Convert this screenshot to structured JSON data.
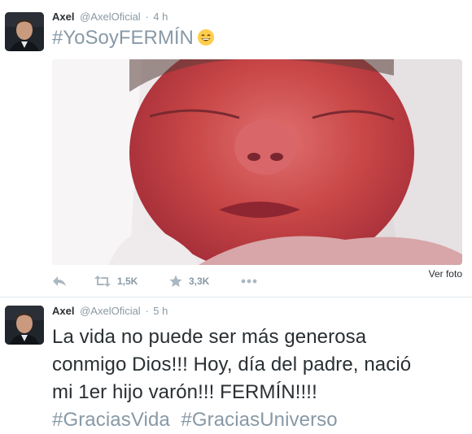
{
  "tweets": [
    {
      "name": "Axel",
      "handle": "@AxelOficial",
      "separator": "·",
      "time": "4 h",
      "hashtag": "#YoSoyFERMÍN",
      "emoji_icon": "grinning-face-icon",
      "photo_link": "Ver foto",
      "actions": {
        "reply_icon": "reply-icon",
        "retweet_icon": "retweet-icon",
        "retweet_count": "1,5K",
        "favorite_icon": "star-icon",
        "favorite_count": "3,3K",
        "more_icon": "more-icon"
      }
    },
    {
      "name": "Axel",
      "handle": "@AxelOficial",
      "separator": "·",
      "time": "5 h",
      "text_line1": "La vida no puede ser más generosa",
      "text_line2": "conmigo Dios!!! Hoy, día del padre, nació",
      "text_line3": "mi 1er hijo varón!!! FERMÍN!!!!",
      "hashtag1": "#GraciasVida",
      "hashtag2": "#GraciasUniverso"
    }
  ],
  "colors": {
    "text": "#292f33",
    "muted": "#8899a6",
    "border": "#e1e8ed"
  }
}
